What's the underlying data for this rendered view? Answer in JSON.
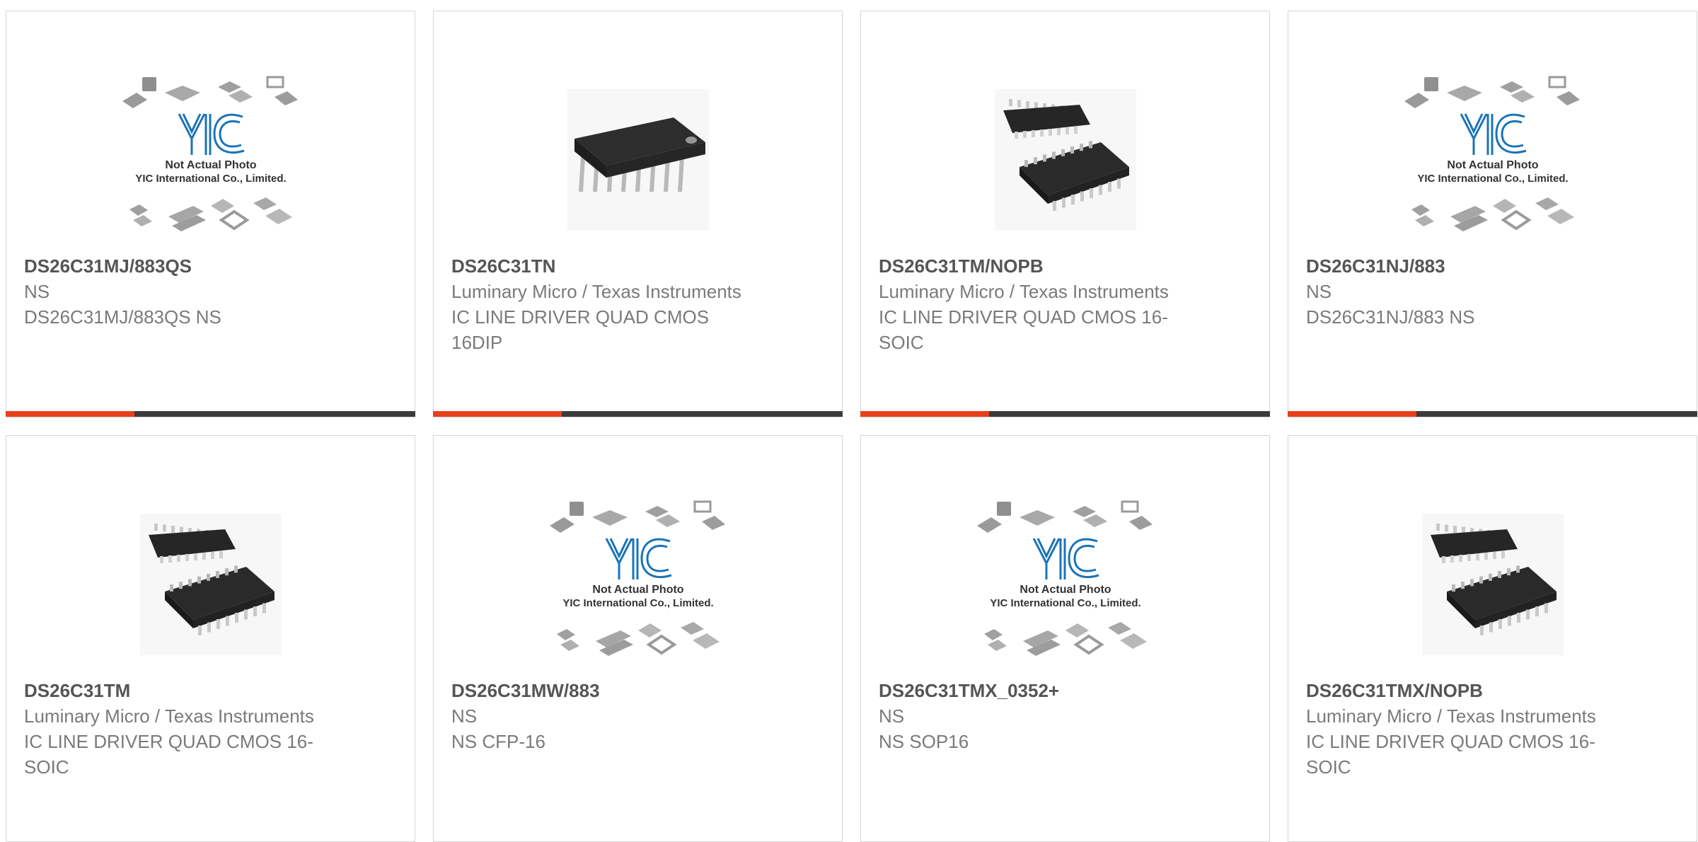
{
  "colors": {
    "accent": "#e8401c",
    "bar": "#3b3b3b",
    "border": "#d6d6d6",
    "title": "#555555",
    "text": "#7a7a7a",
    "logo": "#1a73b8"
  },
  "placeholder": {
    "brand": "YIC",
    "line1": "Not Actual Photo",
    "line2": "YIC International Co., Limited."
  },
  "products": [
    {
      "part": "DS26C31MJ/883QS",
      "manufacturer": "NS",
      "description": "DS26C31MJ/883QS NS",
      "image": "placeholder"
    },
    {
      "part": "DS26C31TN",
      "manufacturer": "Luminary Micro / Texas Instruments",
      "description": "IC LINE DRIVER QUAD CMOS 16DIP",
      "image": "dip-chip"
    },
    {
      "part": "DS26C31TM/NOPB",
      "manufacturer": "Luminary Micro / Texas Instruments",
      "description": "IC LINE DRIVER QUAD CMOS 16-SOIC",
      "image": "soic-chips"
    },
    {
      "part": "DS26C31NJ/883",
      "manufacturer": "NS",
      "description": "DS26C31NJ/883 NS",
      "image": "placeholder"
    },
    {
      "part": "DS26C31TM",
      "manufacturer": "Luminary Micro / Texas Instruments",
      "description": "IC LINE DRIVER QUAD CMOS 16-SOIC",
      "image": "soic-chips"
    },
    {
      "part": "DS26C31MW/883",
      "manufacturer": "NS",
      "description": "NS CFP-16",
      "image": "placeholder"
    },
    {
      "part": "DS26C31TMX_0352+",
      "manufacturer": "NS",
      "description": "NS SOP16",
      "image": "placeholder"
    },
    {
      "part": "DS26C31TMX/NOPB",
      "manufacturer": "Luminary Micro / Texas Instruments",
      "description": "IC LINE DRIVER QUAD CMOS 16-SOIC",
      "image": "soic-chips"
    }
  ]
}
